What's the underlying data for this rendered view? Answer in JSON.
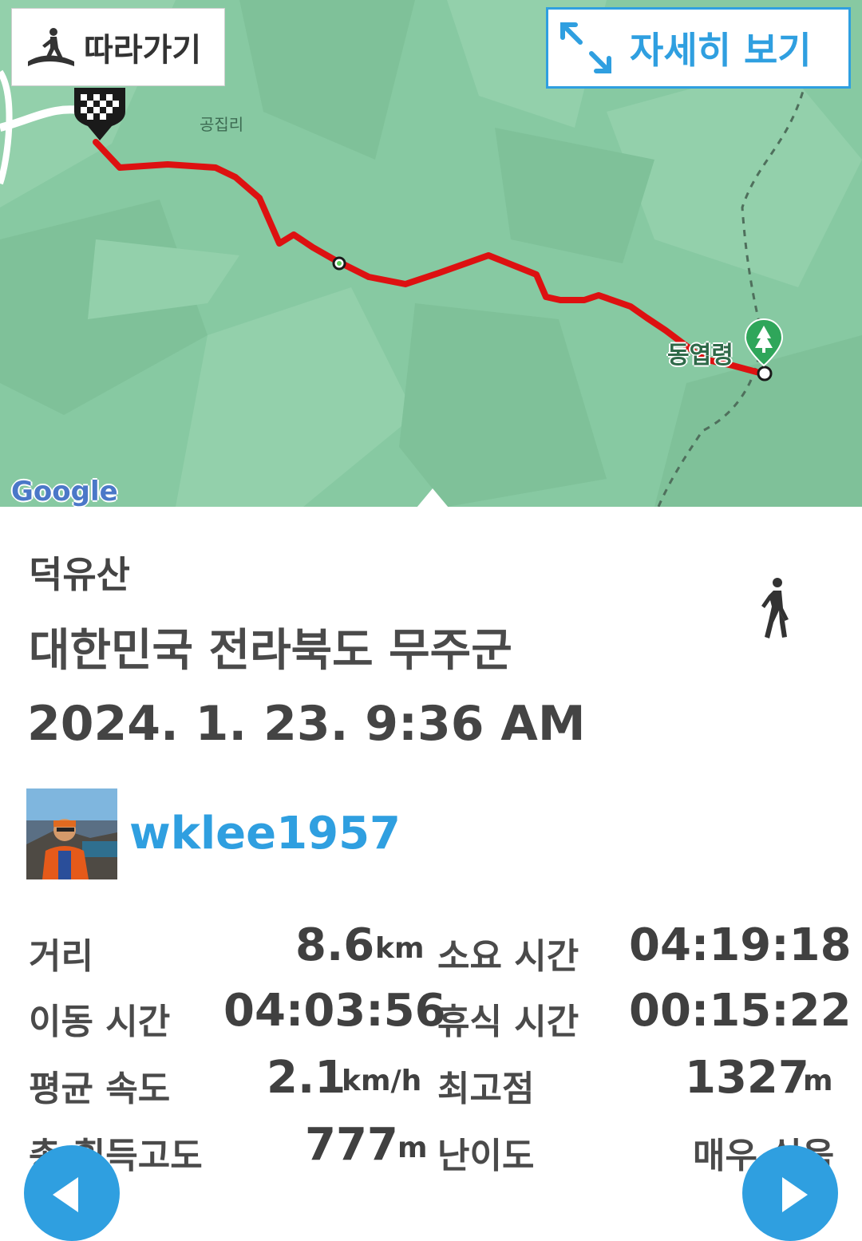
{
  "map": {
    "follow_label": "따라가기",
    "detail_label": "자세히 보기",
    "place_label": "공집리",
    "pass_label": "동엽령",
    "google_logo": "Google",
    "colors": {
      "route": "#dd1111",
      "accent": "#2f9fe0",
      "terrain": "#87c9a2"
    }
  },
  "track": {
    "mountain": "덕유산",
    "region": "대한민국 전라북도 무주군",
    "datetime": "2024. 1. 23. 9:36 AM",
    "activity_icon": "walking-person-icon"
  },
  "user": {
    "name": "wklee1957"
  },
  "stats": {
    "distance_label": "거리",
    "distance_value": "8.6",
    "distance_unit": "km",
    "duration_label": "소요 시간",
    "duration_value": "04:19:18",
    "moving_label": "이동 시간",
    "moving_value": "04:03:56",
    "rest_label": "휴식 시간",
    "rest_value": "00:15:22",
    "avg_speed_label": "평균 속도",
    "avg_speed_value": "2.1",
    "avg_speed_unit": "km/h",
    "highest_label": "최고점",
    "highest_value": "1327",
    "highest_unit": "m",
    "ascent_label": "총 획득고도",
    "ascent_value": "777",
    "ascent_unit": "m",
    "difficulty_label": "난이도",
    "difficulty_value": "매우 쉬움"
  }
}
